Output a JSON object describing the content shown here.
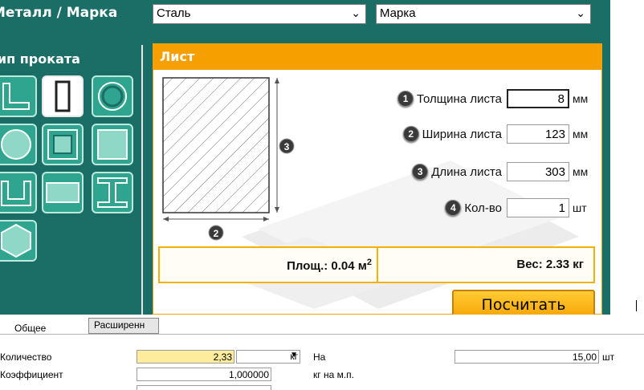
{
  "calculator": {
    "title": "Металл / Марка",
    "metal_select": "Сталь",
    "grade_select": "Марка",
    "rolled_type_title": "Тип проката",
    "panel_title": "Лист",
    "fields": [
      {
        "badge": "1",
        "label": "Толщина листа",
        "value": "8",
        "unit": "мм"
      },
      {
        "badge": "2",
        "label": "Ширина листа",
        "value": "123",
        "unit": "мм"
      },
      {
        "badge": "3",
        "label": "Длина листа",
        "value": "303",
        "unit": "мм"
      },
      {
        "badge": "4",
        "label": "Кол-во",
        "value": "1",
        "unit": "шт"
      }
    ],
    "drawing_marks": {
      "height": "3",
      "width": "2"
    },
    "area_label": "Площ.: 0.04 м",
    "area_sup": "2",
    "weight_label": "Вес: 2.33 кг",
    "calc_button": "Посчитать",
    "colors": {
      "teal": "#1b6e66",
      "orange": "#f5a000",
      "button": "#ffc32e"
    }
  },
  "form": {
    "tabs": [
      "Общее",
      "Расширенн"
    ],
    "quantity_label": "Количество",
    "quantity_value": "2,33",
    "quantity_unit": "кг",
    "coefficient_label": "Коэффициент",
    "coefficient_value": "1,000000",
    "per_label": "На",
    "per_value": "15,00",
    "per_unit": "шт",
    "kg_per_meter_label": "кг на м.п."
  }
}
